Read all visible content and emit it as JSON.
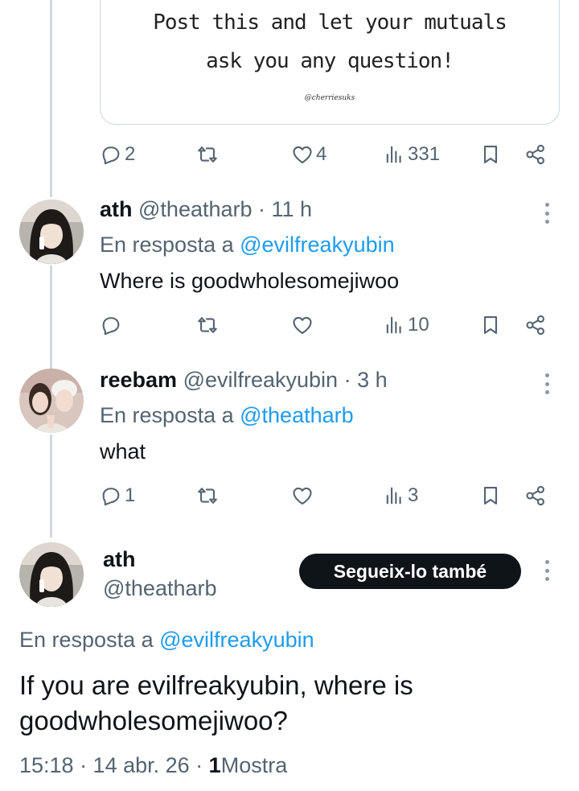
{
  "quote": {
    "line1": "Post this and let your mutuals",
    "line2": "ask you any question!",
    "credit": "@cherriesuks"
  },
  "top_actions": {
    "replies": "2",
    "likes": "4",
    "views": "331"
  },
  "reply1": {
    "name": "ath",
    "handle": "@theatharb",
    "time": "· 11 h",
    "reply_prefix": "En resposta a",
    "reply_to": "@evilfreakyubin",
    "text": "Where is goodwholesomejiwoo",
    "views": "10"
  },
  "reply2": {
    "name": "reebam",
    "handle": "@evilfreakyubin",
    "time": "· 3 h",
    "reply_prefix": "En resposta a",
    "reply_to": "@theatharb",
    "text": "what",
    "replies": "1",
    "views": "3"
  },
  "main_tweet": {
    "name": "ath",
    "handle": "@theatharb",
    "follow_label": "Segueix-lo també",
    "reply_prefix": "En resposta a",
    "reply_to": "@evilfreakyubin",
    "text_line1": "If you are evilfreakyubin, where is",
    "text_line2": "goodwholesomejiwoo?",
    "timestamp": "15:18 · 14 abr. 26 ·",
    "views_count": "1",
    "views_label": "Mostra"
  },
  "icons": {
    "reply": "reply-icon",
    "retweet": "retweet-icon",
    "like": "heart-icon",
    "views": "views-icon",
    "bookmark": "bookmark-icon",
    "share": "share-icon",
    "more": "more-vertical-icon"
  },
  "colors": {
    "accent": "#1d9bf0",
    "secondary_text": "#536471",
    "primary_text": "#0f1419",
    "thread_line": "#cfd9de"
  }
}
